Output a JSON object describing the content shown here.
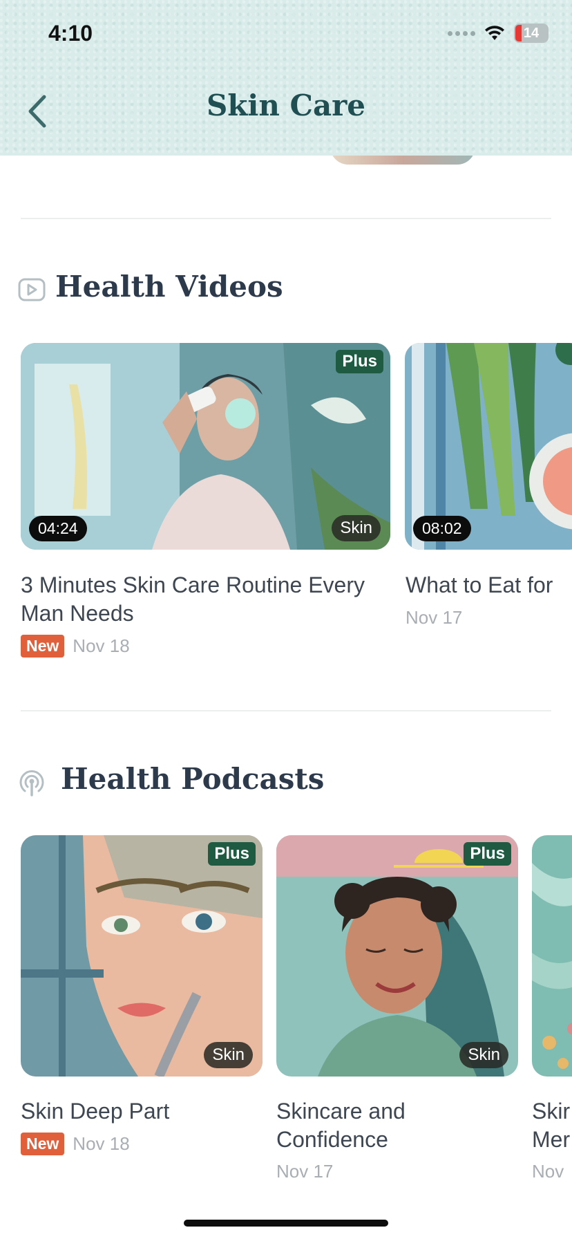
{
  "status": {
    "time": "4:10",
    "battery": "14"
  },
  "header": {
    "title": "Skin Care"
  },
  "videos": {
    "section_title": "Health Videos",
    "items": [
      {
        "title": "3 Minutes Skin Care Routine Every Man Needs",
        "duration": "04:24",
        "plus": "Plus",
        "tag": "Skin",
        "new": "New",
        "date": "Nov 18"
      },
      {
        "title": "What to Eat for",
        "duration": "08:02",
        "date": "Nov 17"
      }
    ]
  },
  "podcasts": {
    "section_title": "Health Podcasts",
    "items": [
      {
        "title": "Skin Deep Part",
        "plus": "Plus",
        "tag": "Skin",
        "new": "New",
        "date": "Nov 18"
      },
      {
        "title": "Skincare and Confidence",
        "plus": "Plus",
        "tag": "Skin",
        "date": "Nov 17"
      },
      {
        "title_line1": "Skir",
        "title_line2": "Mer",
        "date": "Nov"
      }
    ]
  }
}
